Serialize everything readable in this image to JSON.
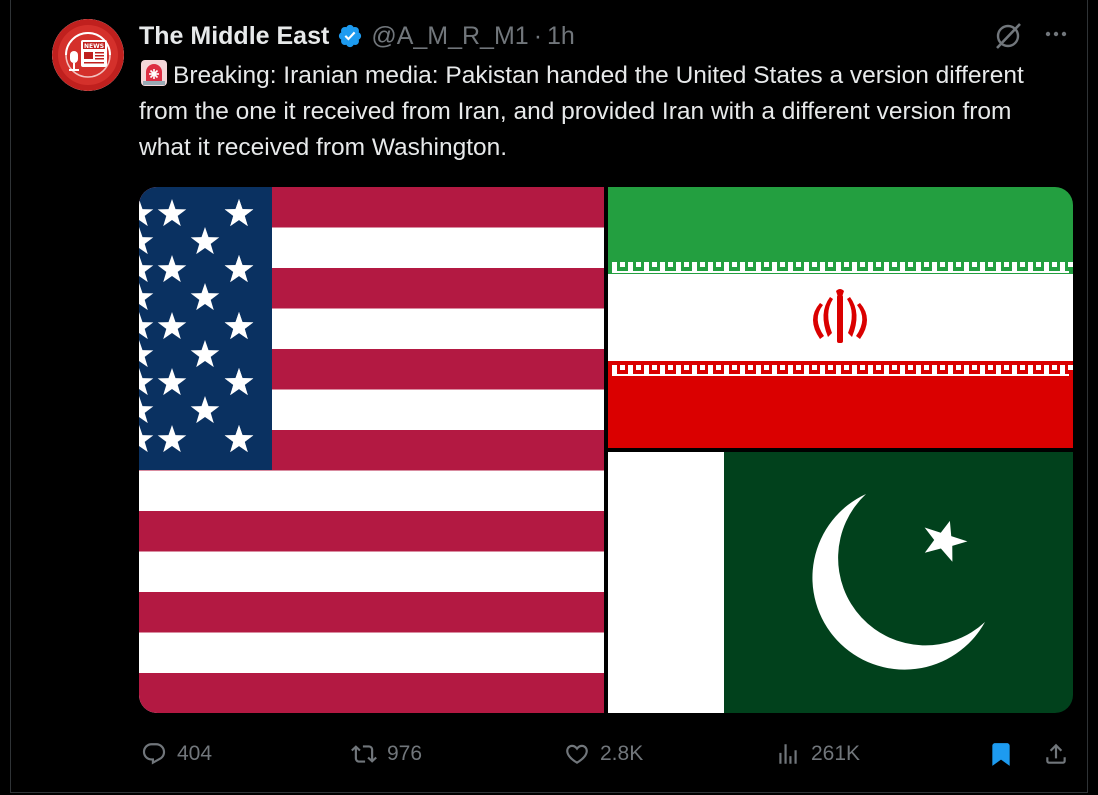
{
  "tweet": {
    "author_name": "The Middle East",
    "handle": "@A_M_R_M1",
    "separator": "·",
    "time": "1h",
    "avatar_text": "NEWS",
    "text": "Breaking: Iranian media: Pakistan handed the United States a version different from the one it received from Iran, and provided Iran with a different version from what it received from Washington.",
    "emoji": "police-light-emoji",
    "media": [
      "us-flag-image",
      "iran-flag-image",
      "pakistan-flag-image"
    ]
  },
  "actions": {
    "replies": "404",
    "reposts": "976",
    "likes": "2.8K",
    "views": "261K"
  },
  "colors": {
    "accent": "#1d9bf0",
    "muted": "#71767b",
    "text": "#e7e9ea",
    "avatar_red": "#c0201e"
  }
}
